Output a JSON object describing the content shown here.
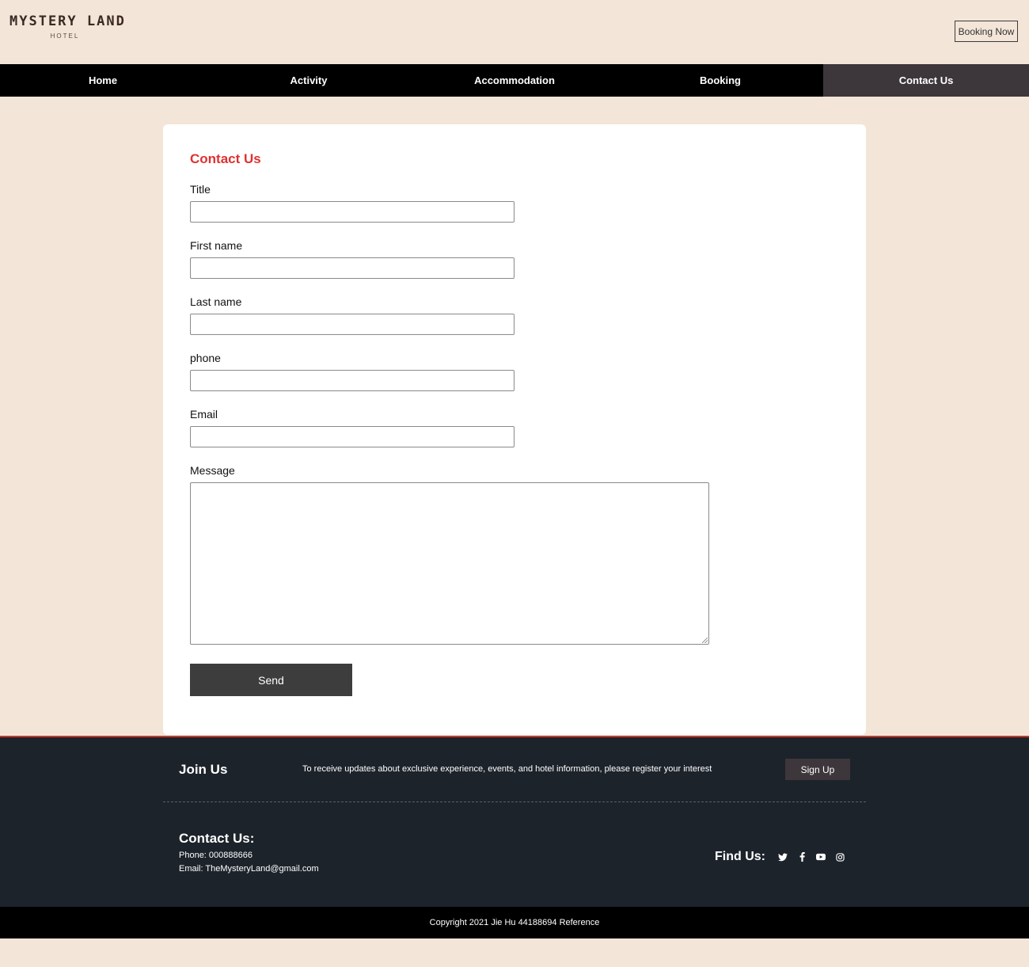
{
  "header": {
    "logo_main": "MYSTERY LAND",
    "logo_sub": "HOTEL",
    "booking_button": "Booking Now"
  },
  "nav": {
    "items": [
      {
        "label": "Home"
      },
      {
        "label": "Activity"
      },
      {
        "label": "Accommodation"
      },
      {
        "label": "Booking"
      },
      {
        "label": "Contact Us"
      }
    ],
    "active": "Contact Us"
  },
  "form": {
    "title": "Contact Us",
    "fields": {
      "title": {
        "label": "Title",
        "value": ""
      },
      "first_name": {
        "label": "First name",
        "value": ""
      },
      "last_name": {
        "label": "Last name",
        "value": ""
      },
      "phone": {
        "label": "phone",
        "value": ""
      },
      "email": {
        "label": "Email",
        "value": ""
      },
      "message": {
        "label": "Message",
        "value": ""
      }
    },
    "send_label": "Send"
  },
  "footer": {
    "join_title": "Join Us",
    "join_text": "To receive updates about exclusive experience, events, and hotel information, please register your interest",
    "signup_label": "Sign Up",
    "contact_title": "Contact Us:",
    "phone_line": "Phone: 000888666",
    "email_line": "Email: TheMysteryLand@gmail.com",
    "find_title": "Find Us:",
    "social_icons": [
      "twitter-icon",
      "facebook-icon",
      "youtube-icon",
      "instagram-icon"
    ],
    "copyright": "Copyright 2021 Jie Hu 44188694 Reference"
  },
  "colors": {
    "background": "#f3e5d8",
    "nav_bg": "#000000",
    "nav_active": "#3d373c",
    "accent_red": "#e03131",
    "footer_bg": "#1c232b",
    "button_dark": "#3d3d3d"
  }
}
